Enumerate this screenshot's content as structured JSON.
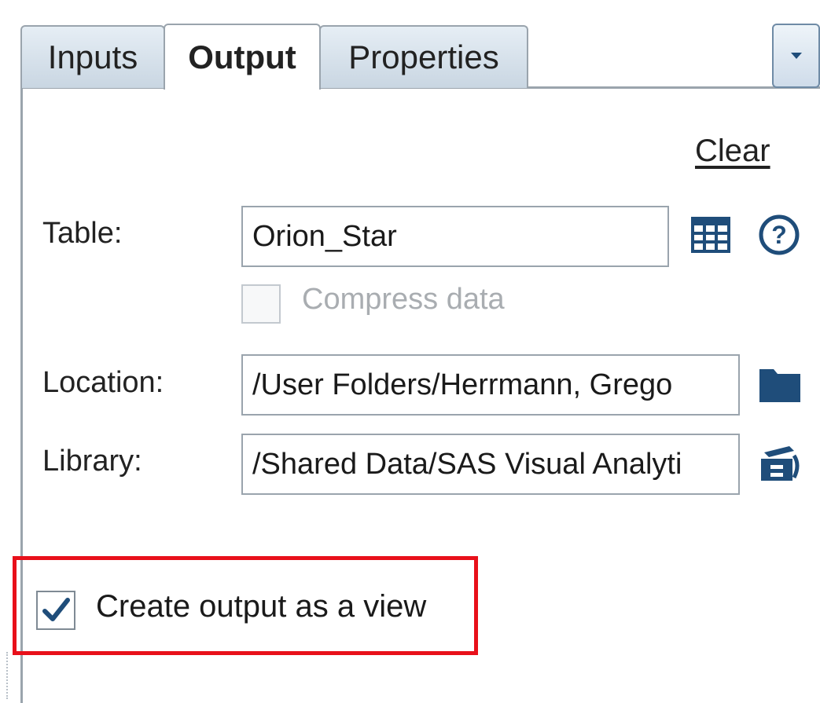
{
  "tabs": [
    {
      "label": "Inputs",
      "active": false
    },
    {
      "label": "Output",
      "active": true
    },
    {
      "label": "Properties",
      "active": false
    }
  ],
  "toolbar": {
    "menu_icon": "chevron-down-icon",
    "clear_label": "Clear"
  },
  "form": {
    "table_label": "Table:",
    "table_value": "Orion_Star",
    "table_icon": "table-grid-icon",
    "help_icon": "help-icon",
    "compress_label": "Compress data",
    "compress_checked": false,
    "compress_enabled": false,
    "location_label": "Location:",
    "location_value": "/User Folders/Herrmann, Grego",
    "location_icon": "folder-icon",
    "library_label": "Library:",
    "library_value": "/Shared Data/SAS Visual Analyti",
    "library_icon": "library-icon"
  },
  "view_option": {
    "label": "Create output as a view",
    "checked": true,
    "highlight_color": "#e8101a"
  },
  "colors": {
    "accent": "#1f4d7a",
    "border": "#9aa4ad"
  }
}
